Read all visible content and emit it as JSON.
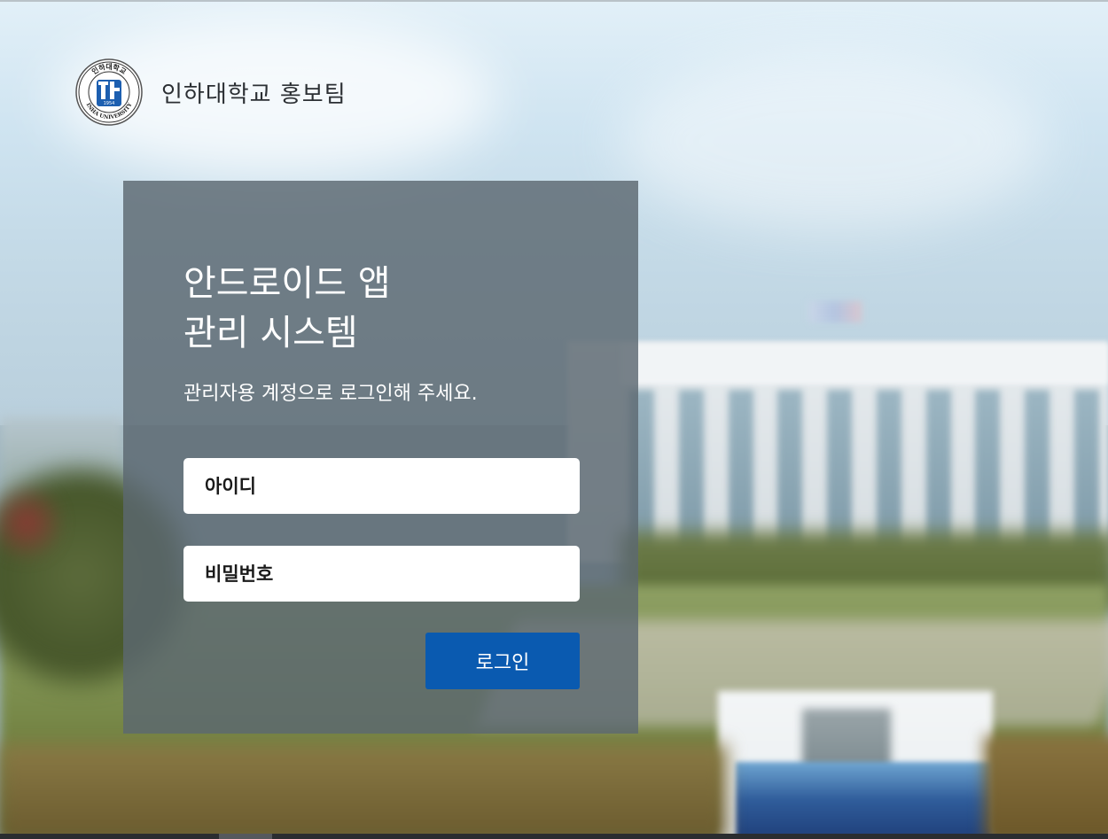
{
  "header": {
    "org_name": "인하대학교 홍보팀",
    "logo_icon": "inha-university-seal-icon",
    "logo_text_top": "인하대학교",
    "logo_text_bottom": "INHA UNIVERSITY",
    "logo_year": "1954"
  },
  "login": {
    "title_line1": "안드로이드 앱",
    "title_line2": "관리 시스템",
    "subtitle": "관리자용 계정으로 로그인해 주세요.",
    "id_placeholder": "아이디",
    "id_value": "",
    "password_placeholder": "비밀번호",
    "password_value": "",
    "login_button_label": "로그인"
  },
  "colors": {
    "panel_bg": "#5c6870",
    "button_bg": "#0a5ab0",
    "text_on_panel": "#ffffff",
    "header_text": "#2b2f33"
  }
}
